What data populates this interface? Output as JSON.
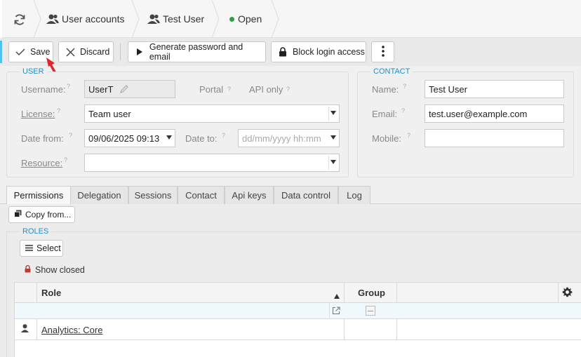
{
  "breadcrumb": {
    "refresh_icon": "refresh-icon",
    "items": [
      {
        "label": "User accounts",
        "icon": "users-icon"
      },
      {
        "label": "Test User",
        "icon": "users-icon"
      },
      {
        "label": "Open",
        "status_color": "#2ea043"
      }
    ]
  },
  "toolbar": {
    "save_label": "Save",
    "discard_label": "Discard",
    "generate_label": "Generate password and email",
    "block_label": "Block login access"
  },
  "user_section": {
    "legend": "USER",
    "username_label": "Username:",
    "username_value": "UserT",
    "portal_label": "Portal",
    "api_only_label": "API only",
    "license_label": "License:",
    "license_value": "Team user",
    "date_from_label": "Date from:",
    "date_from_value": "09/06/2025 09:13",
    "date_to_label": "Date to:",
    "date_to_placeholder": "dd/mm/yyyy hh:mm",
    "resource_label": "Resource:",
    "resource_value": "",
    "help_mark": "?"
  },
  "contact_section": {
    "legend": "CONTACT",
    "name_label": "Name:",
    "name_value": "Test User",
    "email_label": "Email:",
    "email_value": "test.user@example.com",
    "mobile_label": "Mobile:",
    "mobile_value": ""
  },
  "tabs": [
    "Permissions",
    "Delegation",
    "Sessions",
    "Contact",
    "Api keys",
    "Data control",
    "Log"
  ],
  "permissions": {
    "copy_from_label": "Copy from...",
    "roles_legend": "ROLES",
    "select_label": "Select",
    "show_closed_label": "Show closed",
    "columns": {
      "role": "Role",
      "group": "Group"
    },
    "rows": [
      {
        "role": "Analytics: Core",
        "group": ""
      }
    ]
  },
  "colors": {
    "accent": "#1e90c8",
    "status_open": "#2ea043",
    "lock_red": "#c0392b",
    "arrow_red": "#e0262a"
  }
}
